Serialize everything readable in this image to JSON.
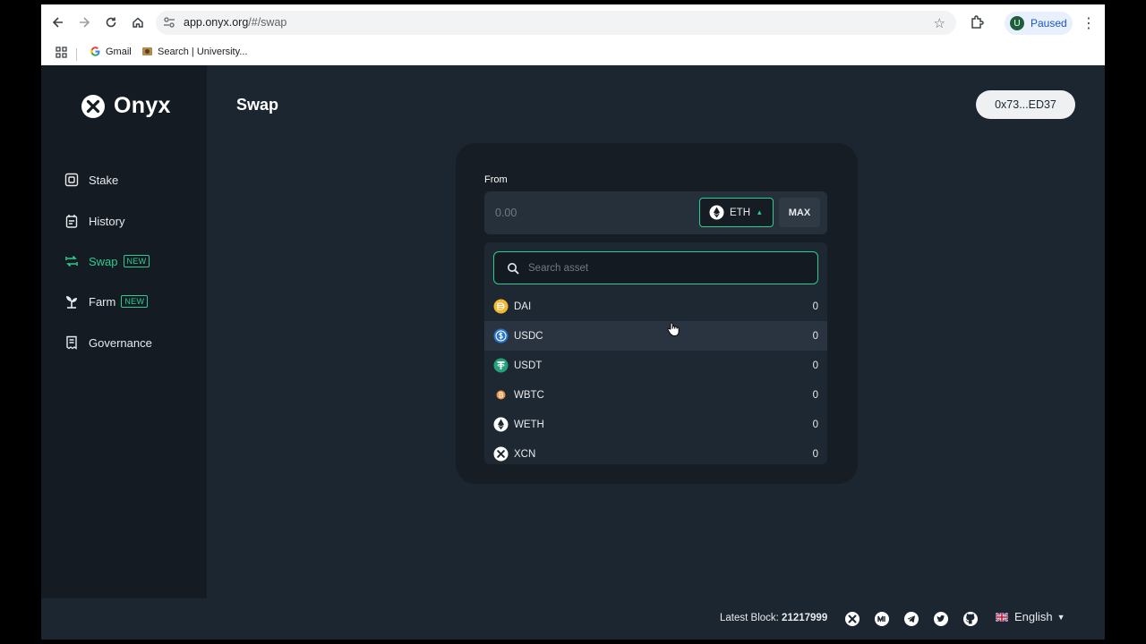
{
  "browser": {
    "url_host": "app.onyx.org",
    "url_path": "/#/swap",
    "profile_initial": "U",
    "profile_status": "Paused",
    "bookmarks": [
      {
        "label": "Gmail"
      },
      {
        "label": "Search | University..."
      }
    ]
  },
  "app": {
    "brand": "Onyx",
    "page_title": "Swap",
    "wallet_address": "0x73...ED37",
    "nav": [
      {
        "label": "Stake",
        "icon": "stake-icon",
        "badge": ""
      },
      {
        "label": "History",
        "icon": "history-icon",
        "badge": ""
      },
      {
        "label": "Swap",
        "icon": "swap-icon",
        "badge": "NEW",
        "active": true
      },
      {
        "label": "Farm",
        "icon": "farm-icon",
        "badge": "NEW"
      },
      {
        "label": "Governance",
        "icon": "governance-icon",
        "badge": ""
      }
    ],
    "accent_color": "#2ecc8f"
  },
  "swap": {
    "from_label": "From",
    "amount_placeholder": "0.00",
    "selected_token": "ETH",
    "max_label": "MAX",
    "search_placeholder": "Search asset",
    "assets": [
      {
        "symbol": "DAI",
        "balance": "0",
        "color": "#f4b731"
      },
      {
        "symbol": "USDC",
        "balance": "0",
        "color": "#2775ca"
      },
      {
        "symbol": "USDT",
        "balance": "0",
        "color": "#26a17b"
      },
      {
        "symbol": "WBTC",
        "balance": "0",
        "color": "#f09242"
      },
      {
        "symbol": "WETH",
        "balance": "0",
        "color": "#ffffff"
      },
      {
        "symbol": "XCN",
        "balance": "0",
        "color": "#ffffff"
      }
    ]
  },
  "footer": {
    "latest_block_label": "Latest Block:",
    "latest_block_value": "21217999",
    "language": "English",
    "social_icons": [
      "onyx-icon",
      "medium-icon",
      "telegram-icon",
      "twitter-icon",
      "github-icon"
    ]
  }
}
